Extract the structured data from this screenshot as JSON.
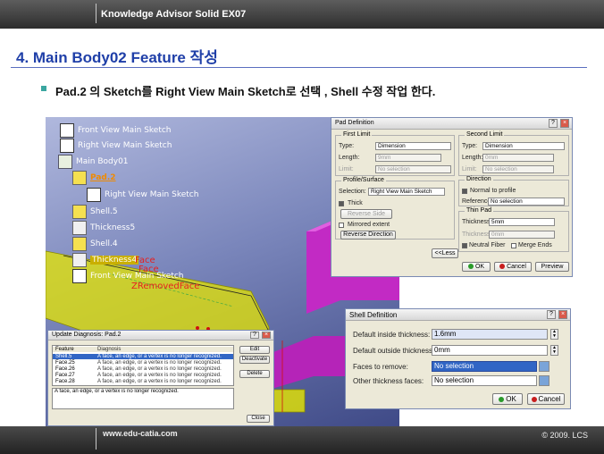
{
  "header": {
    "title": "Knowledge Advisor Solid  EX07"
  },
  "slide": {
    "title": "4. Main Body02 Feature 작성",
    "bullet": "Pad.2 의 Sketch를 Right View Main Sketch로 선택 , Shell 수정 작업 한다."
  },
  "footer": {
    "website": "www.edu-catia.com",
    "copyright": "© 2009. LCS"
  },
  "tree": {
    "items": [
      "Front View Main Sketch",
      "Right View Main Sketch",
      "Main Body01",
      "Pad.2",
      "Right View Main Sketch",
      "Shell.5",
      "Thickness5",
      "Shell.4",
      "Thickness4",
      "Front View Main Sketch"
    ],
    "overlay_faces": [
      "Face",
      "Face",
      "ZRemovedFace"
    ]
  },
  "pad_dialog": {
    "title": "Pad Definition",
    "first_limit": {
      "label": "First Limit",
      "type_label": "Type:",
      "type_value": "Dimension",
      "length_label": "Length:",
      "length_value": "9mm",
      "limit_label": "Limit:",
      "limit_value": "No selection"
    },
    "profile": {
      "label": "Profile/Surface",
      "selection_label": "Selection:",
      "selection_value": "Right View Main Sketch",
      "thick_label": "Thick",
      "reverse_side": "Reverse Side",
      "mirrored_label": "Mirrored extent",
      "reverse_direction": "Reverse Direction"
    },
    "second_limit": {
      "label": "Second Limit",
      "type_label": "Type:",
      "type_value": "Dimension",
      "length_label": "Length:",
      "length_value": "0mm",
      "limit_label": "Limit:",
      "limit_value": "No selection"
    },
    "direction": {
      "label": "Direction",
      "normal_label": "Normal to profile",
      "reference_label": "Reference:",
      "reference_value": "No selection"
    },
    "thin_pad": {
      "label": "Thin Pad",
      "thickness1_label": "Thickness1:",
      "thickness1_value": "5mm",
      "thickness2_label": "Thickness2:",
      "thickness2_value": "0mm",
      "neutral_label": "Neutral Fiber",
      "merge_label": "Merge Ends"
    },
    "less_button": "<<Less",
    "ok": "OK",
    "cancel": "Cancel",
    "preview": "Preview"
  },
  "update_dialog": {
    "title": "Update Diagnosis: Pad.2",
    "col_feature": "Feature",
    "col_diagnosis": "Diagnosis",
    "rows": [
      {
        "feature": "Shell.5",
        "diagnosis": "A face, an edge, or a vertex is no longer recognized."
      },
      {
        "feature": "Face.25",
        "diagnosis": "A face, an edge, or a vertex is no longer recognized."
      },
      {
        "feature": "Face.26",
        "diagnosis": "A face, an edge, or a vertex is no longer recognized."
      },
      {
        "feature": "Face.27",
        "diagnosis": "A face, an edge, or a vertex is no longer recognized."
      },
      {
        "feature": "Face.28",
        "diagnosis": "A face, an edge, or a vertex is no longer recognized."
      }
    ],
    "message": "A face, an edge, or a vertex is no longer recognized.",
    "edit": "Edit",
    "deactivate": "Deactivate",
    "delete": "Delete",
    "close": "Close"
  },
  "shell_dialog": {
    "title": "Shell Definition",
    "inside_label": "Default inside thickness:",
    "inside_value": "1.6mm",
    "outside_label": "Default outside thickness:",
    "outside_value": "0mm",
    "faces_remove_label": "Faces to remove:",
    "faces_remove_value": "No selection",
    "other_label": "Other thickness faces:",
    "other_value": "No selection",
    "ok": "OK",
    "cancel": "Cancel"
  },
  "colors": {
    "title": "#1f3fa8",
    "header": "#3a3a3a",
    "selection": "#3166c5",
    "pad_highlight": "#f08a00"
  }
}
